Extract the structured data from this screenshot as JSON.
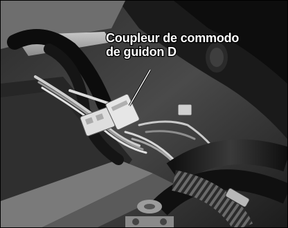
{
  "photo": {
    "label_line_1": "Coupleur de commodo",
    "label_line_2": "de guidon D"
  }
}
